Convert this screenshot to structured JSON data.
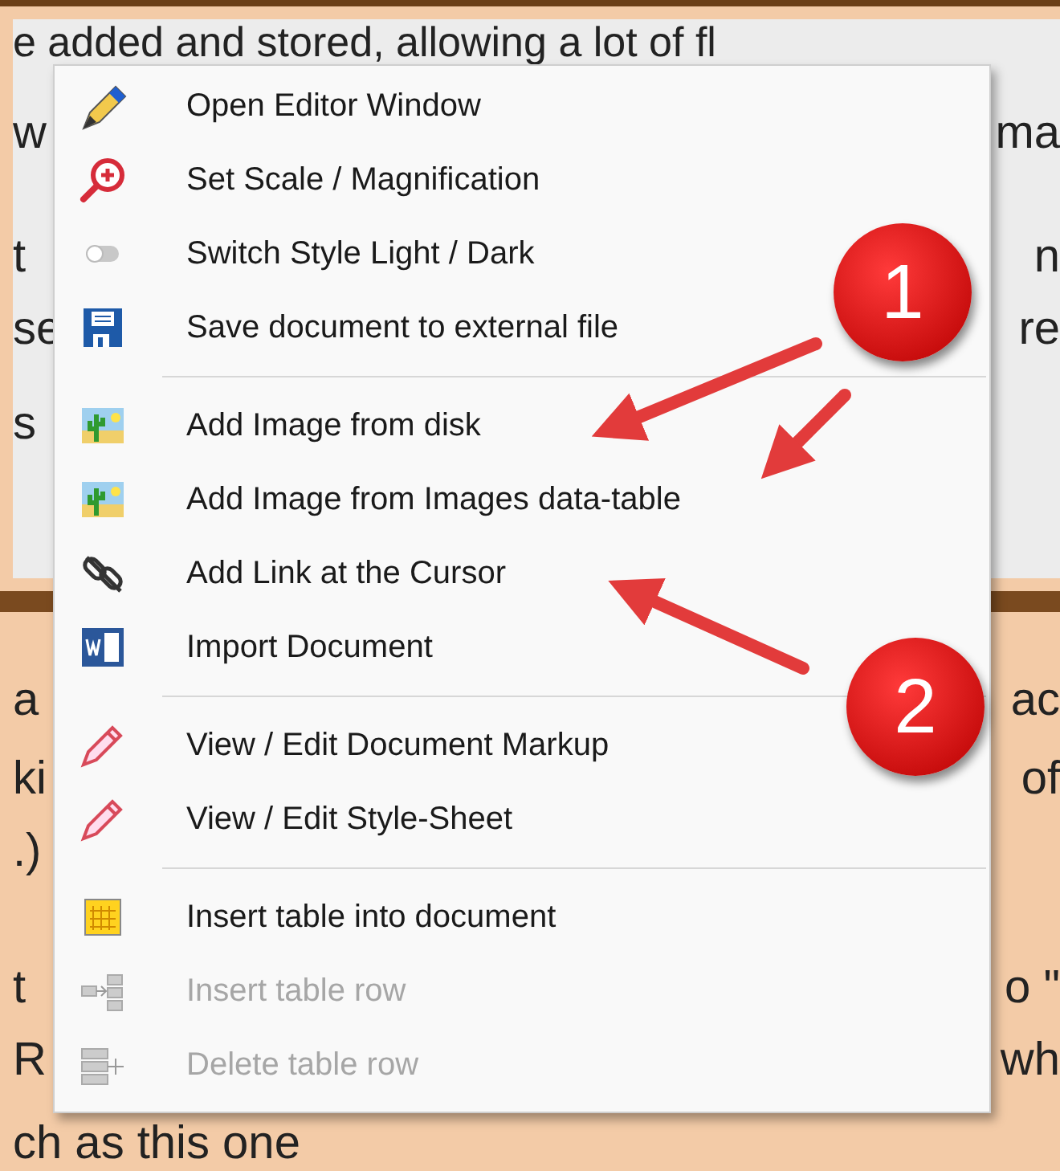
{
  "document": {
    "lines": [
      {
        "left": "e added and stored, allowing a lot of fl"
      },
      {
        "left": "w",
        "right": "ma"
      },
      {
        "left": "t",
        "right": "n"
      },
      {
        "left": "se",
        "right": "re"
      },
      {
        "left": "s"
      },
      {
        "left": "a",
        "right": "ac"
      },
      {
        "left": "ki",
        "right": "of"
      },
      {
        "left": ".)"
      },
      {
        "left": "t",
        "right": "o \""
      },
      {
        "left": "R",
        "right": "wh"
      },
      {
        "left": "ch as this one"
      }
    ]
  },
  "menu": {
    "items": [
      {
        "kind": "item",
        "label": "Open Editor Window",
        "disabled": false
      },
      {
        "kind": "item",
        "label": "Set Scale / Magnification",
        "disabled": false
      },
      {
        "kind": "item",
        "label": "Switch Style Light / Dark",
        "disabled": false
      },
      {
        "kind": "item",
        "label": "Save document to external file",
        "disabled": false
      },
      {
        "kind": "separator"
      },
      {
        "kind": "item",
        "label": "Add Image from disk",
        "disabled": false
      },
      {
        "kind": "item",
        "label": "Add Image from Images data-table",
        "disabled": false
      },
      {
        "kind": "item",
        "label": "Add Link at the Cursor",
        "disabled": false
      },
      {
        "kind": "item",
        "label": "Import Document",
        "disabled": false
      },
      {
        "kind": "separator"
      },
      {
        "kind": "item",
        "label": "View / Edit Document Markup",
        "disabled": false
      },
      {
        "kind": "item",
        "label": "View / Edit Style-Sheet",
        "disabled": false
      },
      {
        "kind": "separator"
      },
      {
        "kind": "item",
        "label": "Insert table into document",
        "disabled": false
      },
      {
        "kind": "item",
        "label": "Insert table row",
        "disabled": true
      },
      {
        "kind": "item",
        "label": "Delete table row",
        "disabled": true
      }
    ]
  },
  "annotations": [
    {
      "label": "1"
    },
    {
      "label": "2"
    }
  ]
}
